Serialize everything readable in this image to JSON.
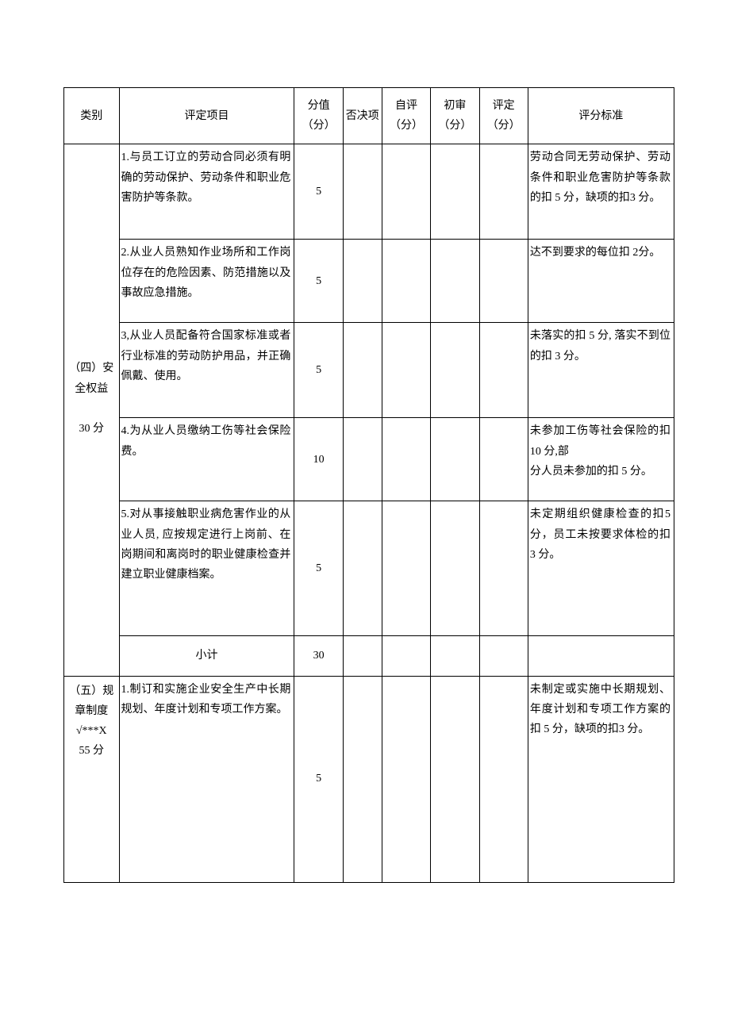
{
  "headers": {
    "category": "类别",
    "item": "评定项目",
    "score": "分值（分）",
    "veto": "否决项",
    "self": "自评（分）",
    "prelim": "初审（分）",
    "final": "评定（分）",
    "standard": "评分标准"
  },
  "sections": [
    {
      "category": "（四）安全权益\n\n30 分",
      "rows": [
        {
          "item": "1.与员工订立的劳动合同必须有明确的劳动保护、劳动条件和职业危害防护等条款。",
          "score": "5",
          "standard": "劳动合同无劳动保护、劳动条件和职业危害防护等条款的扣 5 分，缺项的扣3 分。"
        },
        {
          "item": "2.从业人员熟知作业场所和工作岗位存在的危险因素、防范措施以及事故应急措施。",
          "score": "5",
          "standard": "达不到要求的每位扣 2分。"
        },
        {
          "item": "3,从业人员配备符合国家标准或者行业标准的劳动防护用品，并正确佩戴、使用。",
          "score": "5",
          "standard": "未落实的扣 5 分, 落实不到位的扣 3 分。"
        },
        {
          "item": "4.为从业人员缴纳工伤等社会保险费。",
          "score": "10",
          "standard": "未参加工伤等社会保险的扣 10 分,部\n分人员未参加的扣 5 分。"
        },
        {
          "item": "5.对从事接触职业病危害作业的从业人员, 应按规定进行上岗前、在岗期间和离岗时的职业健康检查并建立职业健康档案。",
          "score": "5",
          "standard": "未定期组织健康检查的扣5 分，员工未按要求体检的扣 3 分。"
        }
      ],
      "subtotal": {
        "label": "小计",
        "score": "30"
      }
    },
    {
      "category": "（五）规章制度\n√***X\n55 分",
      "rows": [
        {
          "item": "1.制订和实施企业安全生产中长期规划、年度计划和专项工作方案。",
          "score": "5",
          "standard": "未制定或实施中长期规划、年度计划和专项工作方案的扣 5 分，缺项的扣3 分。"
        }
      ]
    }
  ]
}
